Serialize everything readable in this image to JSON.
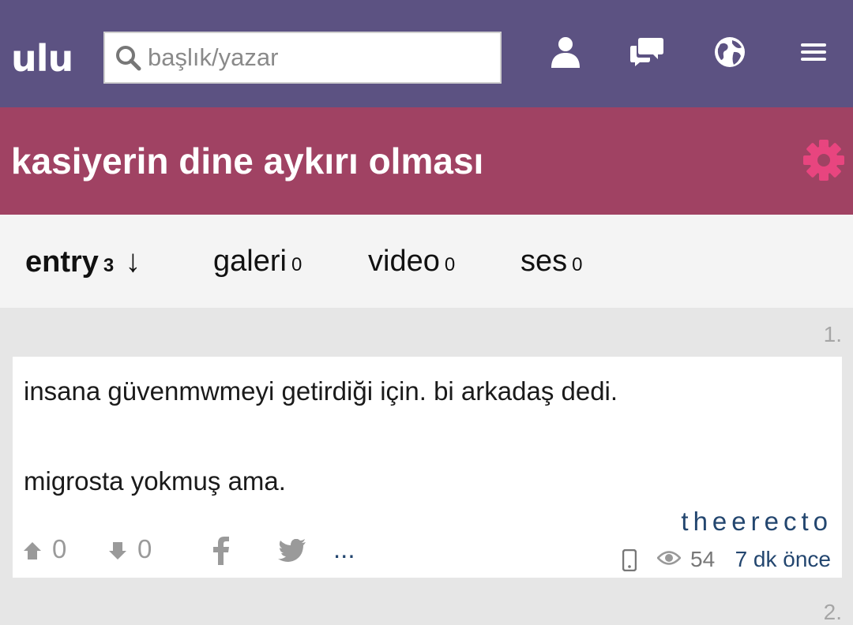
{
  "header": {
    "logo": "ulu",
    "search_placeholder": "başlık/yazar"
  },
  "topic": {
    "title": "kasiyerin dine aykırı olması"
  },
  "tabs": [
    {
      "label": "entry",
      "count": "3",
      "active": true,
      "sort_arrow": "↓"
    },
    {
      "label": "galeri",
      "count": "0"
    },
    {
      "label": "video",
      "count": "0"
    },
    {
      "label": "ses",
      "count": "0"
    }
  ],
  "entry": {
    "number": "1.",
    "line1": "insana güvenmwmeyi getirdiği için. bi arkadaş dedi.",
    "line2": "migrosta yokmuş ama.",
    "author": "theerecto",
    "upvotes": "0",
    "downvotes": "0",
    "more": "...",
    "views": "54",
    "time": "7 dk önce"
  },
  "next_entry_number": "2.",
  "colors": {
    "header_bg": "#5c5282",
    "title_bg": "#a04263",
    "gear": "#e8457f",
    "link": "#23466f"
  },
  "icons": [
    "search-icon",
    "user-icon",
    "messages-icon",
    "globe-icon",
    "menu-icon",
    "gear-icon",
    "upvote-icon",
    "downvote-icon",
    "facebook-icon",
    "twitter-icon",
    "mobile-icon",
    "eye-icon"
  ]
}
